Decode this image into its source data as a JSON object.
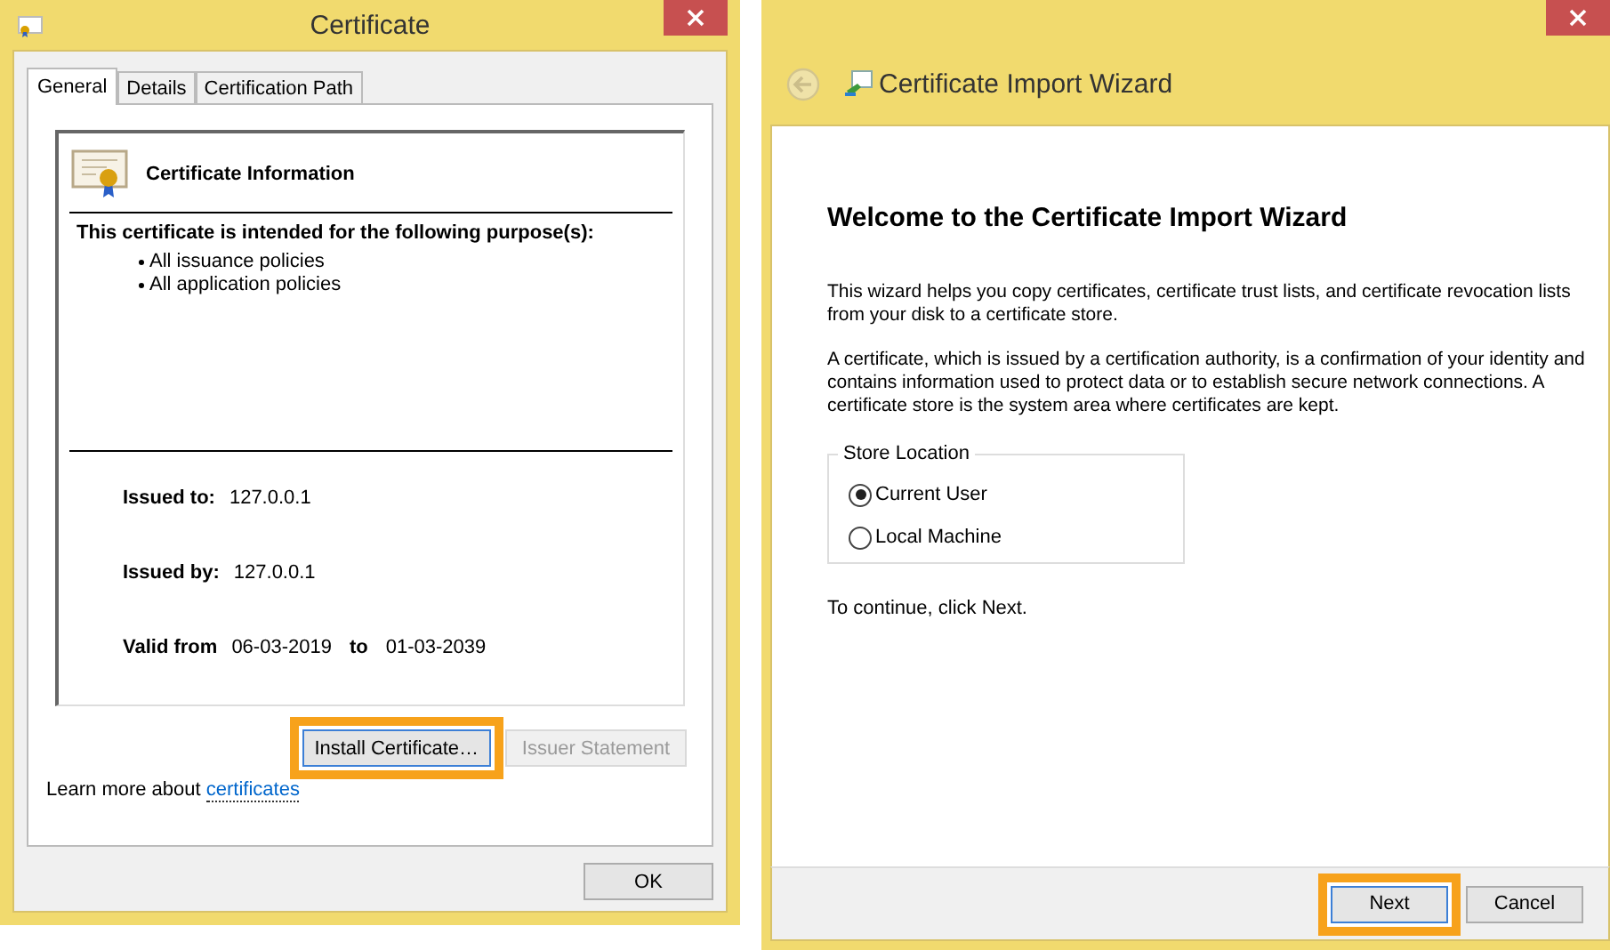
{
  "certificate_window": {
    "title": "Certificate",
    "tabs": [
      {
        "label": "General",
        "selected": true
      },
      {
        "label": "Details",
        "selected": false
      },
      {
        "label": "Certification Path",
        "selected": false
      }
    ],
    "info_title": "Certificate Information",
    "purpose_heading": "This certificate is intended for the following purpose(s):",
    "purposes": [
      "All issuance policies",
      "All application policies"
    ],
    "fields": [
      {
        "label": "Issued to:",
        "value": "127.0.0.1"
      },
      {
        "label": "Issued by:",
        "value": "127.0.0.1"
      }
    ],
    "validity": {
      "label": "Valid from",
      "from": "06-03-2019",
      "separator": "to",
      "to": "01-03-2039"
    },
    "buttons": [
      {
        "label": "Install Certificate…",
        "disabled": false,
        "highlighted": true
      },
      {
        "label": "Issuer Statement",
        "disabled": true,
        "highlighted": false
      }
    ],
    "learn_more": {
      "text": "Learn more about",
      "link": "certificates"
    },
    "ok_button": "OK"
  },
  "wizard_window": {
    "title": "Certificate Import Wizard",
    "heading": "Welcome to the Certificate Import Wizard",
    "paragraphs": [
      "This wizard helps you copy certificates, certificate trust lists, and certificate revocation lists from your disk to a certificate store.",
      "A certificate, which is issued by a certification authority, is a confirmation of your identity and contains information used to protect data or to establish secure network connections. A certificate store is the system area where certificates are kept."
    ],
    "store_location": {
      "legend": "Store Location",
      "options": [
        {
          "label": "Current User",
          "selected": true
        },
        {
          "label": "Local Machine",
          "selected": false
        }
      ]
    },
    "continue_text": "To continue, click Next.",
    "buttons": [
      {
        "label": "Next",
        "highlighted": true
      },
      {
        "label": "Cancel",
        "highlighted": false
      }
    ]
  }
}
